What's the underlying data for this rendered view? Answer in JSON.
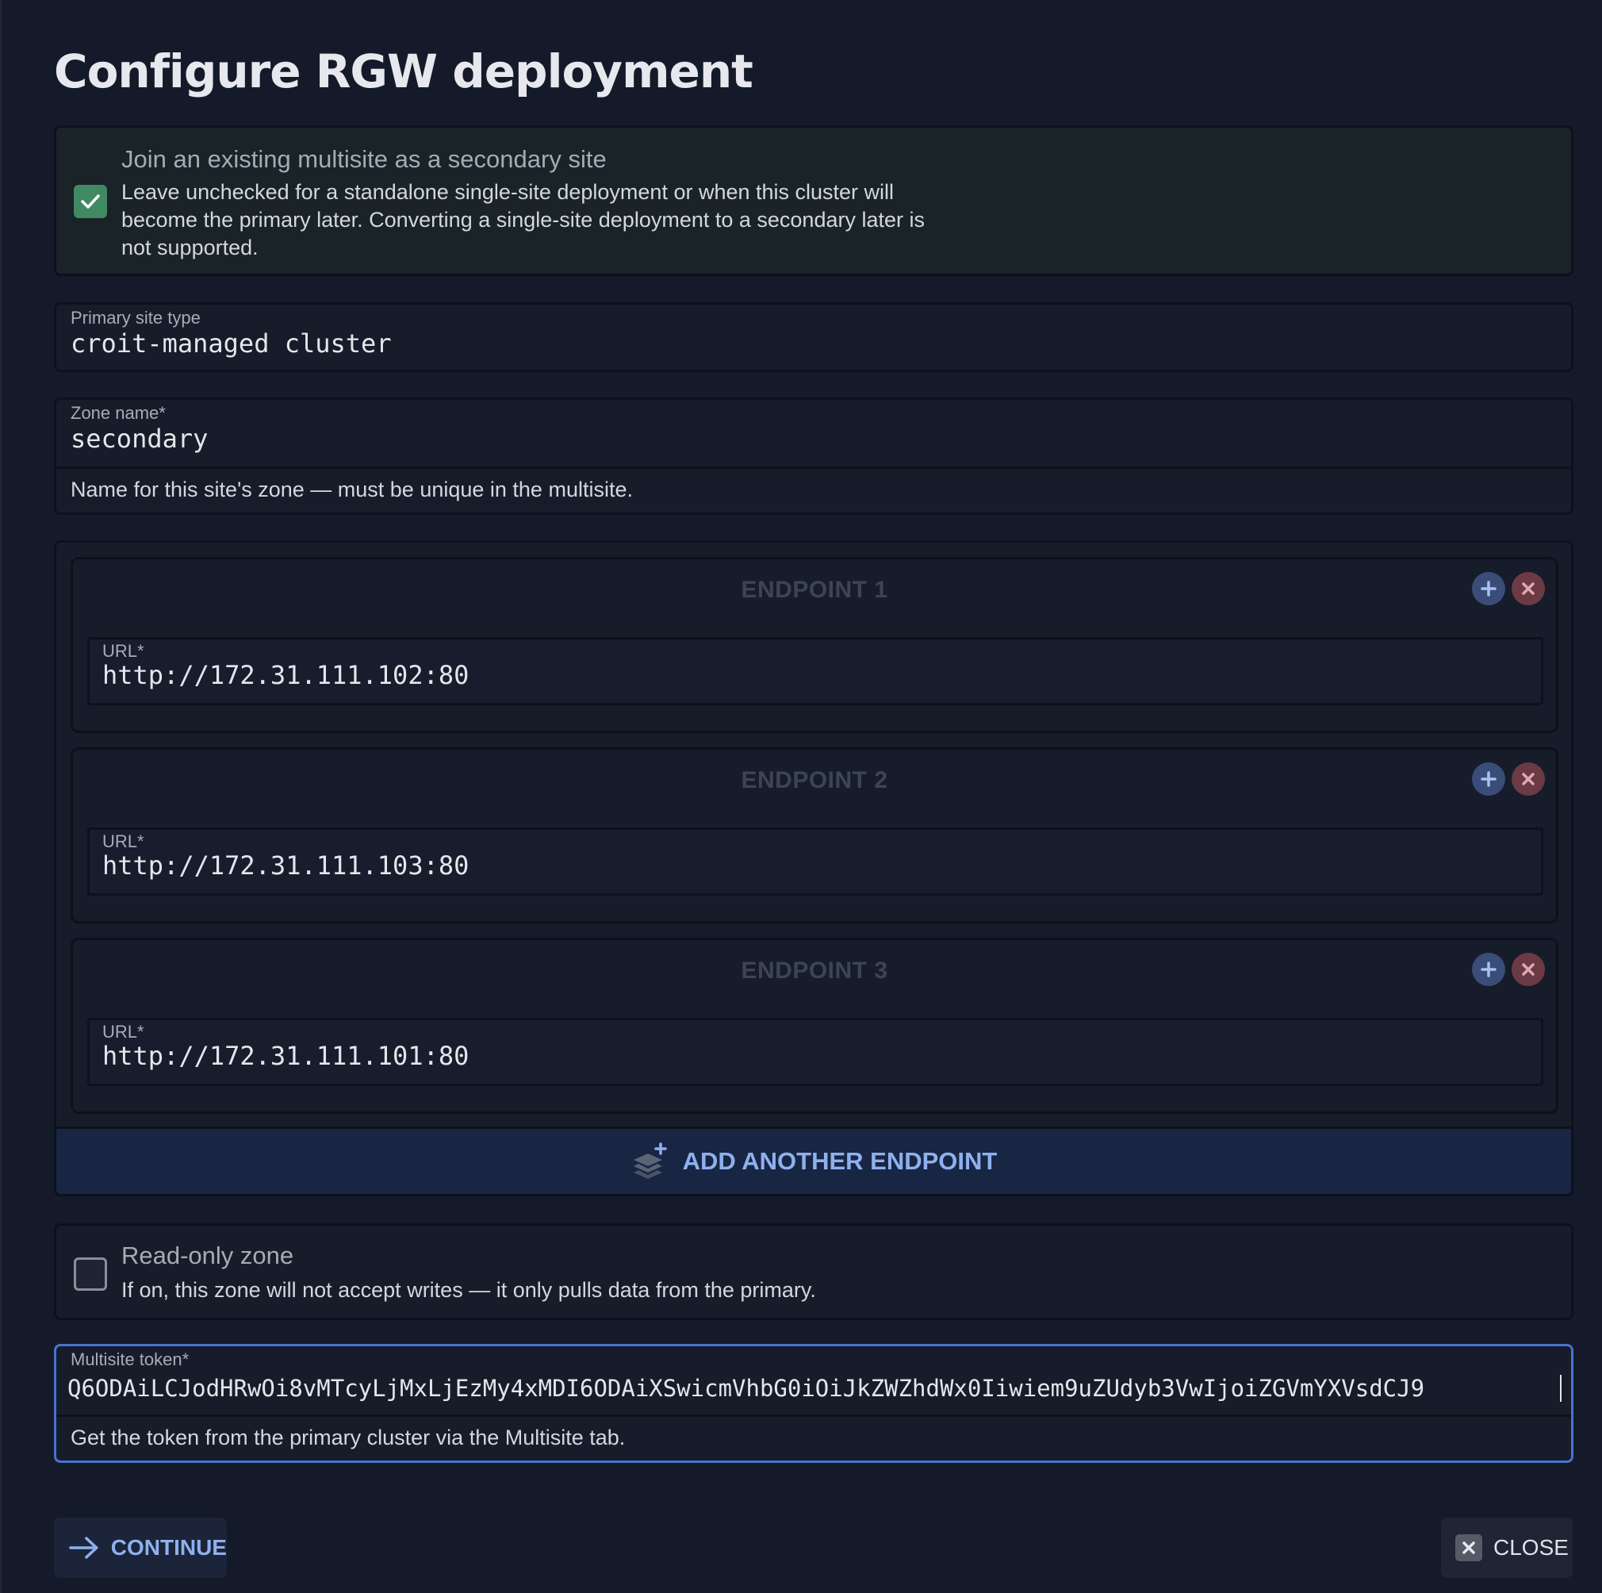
{
  "dialog": {
    "title": "Configure RGW deployment"
  },
  "join_multisite": {
    "checked": true,
    "label": "Join an existing multisite as a secondary site",
    "help_line1": "Leave unchecked for a standalone single-site deployment or when this cluster will",
    "help_line2": "become the primary later. Converting a single-site deployment to a secondary later is",
    "help_line3": "not supported."
  },
  "primary_site_type": {
    "label": "Primary site type",
    "value": "croit-managed cluster"
  },
  "zone_name": {
    "label": "Zone name*",
    "value": "secondary",
    "help": "Name for this site's zone — must be unique in the multisite."
  },
  "endpoints": [
    {
      "title": "ENDPOINT 1",
      "url_label": "URL*",
      "url": "http://172.31.111.102:80"
    },
    {
      "title": "ENDPOINT 2",
      "url_label": "URL*",
      "url": "http://172.31.111.103:80"
    },
    {
      "title": "ENDPOINT 3",
      "url_label": "URL*",
      "url": "http://172.31.111.101:80"
    }
  ],
  "add_endpoint_label": "ADD ANOTHER ENDPOINT",
  "read_only_zone": {
    "checked": false,
    "label": "Read-only zone",
    "help": "If on, this zone will not accept writes — it only pulls data from the primary."
  },
  "multisite_token": {
    "label": "Multisite token*",
    "value": "Q6ODAiLCJodHRwOi8vMTcyLjMxLjEzMy4xMDI6ODAiXSwicmVhbG0iOiJkZWZhdWx0Iiwiem9uZUdyb3VwIjoiZGVmYXVsdCJ9",
    "help": "Get the token from the primary cluster via the Multisite tab."
  },
  "actions": {
    "continue_label": "CONTINUE",
    "close_label": "CLOSE"
  },
  "colors": {
    "accent": "#8fb0ee",
    "checkbox_on": "#3f8a63",
    "focus_border": "#4a72cf"
  }
}
